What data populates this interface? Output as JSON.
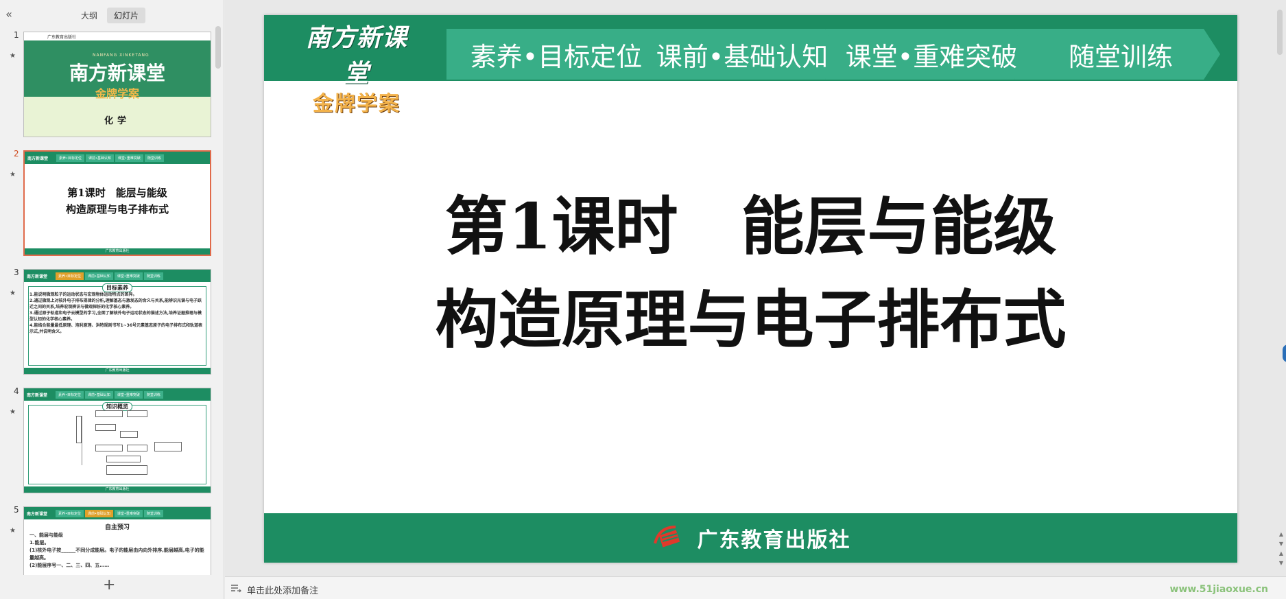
{
  "left_panel": {
    "collapse_glyph": "«",
    "tabs": [
      {
        "label": "大纲",
        "active": false
      },
      {
        "label": "幻灯片",
        "active": true
      }
    ],
    "add_glyph": "+"
  },
  "thumbnails": [
    {
      "num": "1",
      "star": "★",
      "publisher_small": "广东教育出版社",
      "pinyin": "NANFANG XINKETANG",
      "brand": "南方新课堂",
      "brand_sub": "金牌学案",
      "subject": "化学"
    },
    {
      "num": "2",
      "star": "★",
      "title_line1": "第1课时　能层与能级",
      "title_line2": "构造原理与电子排布式"
    },
    {
      "num": "3",
      "star": "★",
      "badge": "目标素养",
      "lines": [
        "1.能说明微观粒子的运动状态与宏观物体运动特点的差异。",
        "2.通过微观上对核外电子排布规律的分析,理解基态与激发态的含义与关系,能辨识光谱与电子跃迁之间的关系,培养宏观辨识与微观探析的化学核心素养。",
        "3.通过原子轨道和电子云模型的学习,全面了解核外电子运动状态的描述方法,培养证据推理与模型认知的化学核心素养。",
        "4.能结合能量最低原理、泡利原理、洪特规则书写1~36号元素基态原子的电子排布式和轨道表示式,并说明含义。"
      ]
    },
    {
      "num": "4",
      "star": "★",
      "badge": "知识概览"
    },
    {
      "num": "5",
      "star": "★",
      "heading": "自主预习",
      "lines": [
        "一、能层与能级",
        "1.能层。",
        "(1)核外电子按______不同分成能层。电子的能层由内向外排序,能层越高,电子的能量越高。",
        "(2)能层序号一、二、三、四、五……"
      ]
    }
  ],
  "mini_header": {
    "logo": "南方新课堂",
    "tabs": [
      "素养•目标定位",
      "课前•基础认知",
      "课堂•重难突破",
      "随堂训练"
    ],
    "footer": "广东教育出版社"
  },
  "slide": {
    "brand_main": "南方新课堂",
    "brand_sub": "金牌学案",
    "nav": [
      "素养•目标定位",
      "课前•基础认知",
      "课堂•重难突破",
      "随堂训练"
    ],
    "title_line1": "第1课时　能层与能级",
    "title_line2": "构造原理与电子排布式",
    "publisher": "广东教育出版社"
  },
  "notes": {
    "placeholder": "单击此处添加备注"
  },
  "watermark": "www.51jiaoxue.cn",
  "colors": {
    "brand_green": "#1d8d62",
    "nav_green": "#38ae87",
    "brand_gold": "#f3b24a",
    "selected_border": "#e06a4a"
  }
}
